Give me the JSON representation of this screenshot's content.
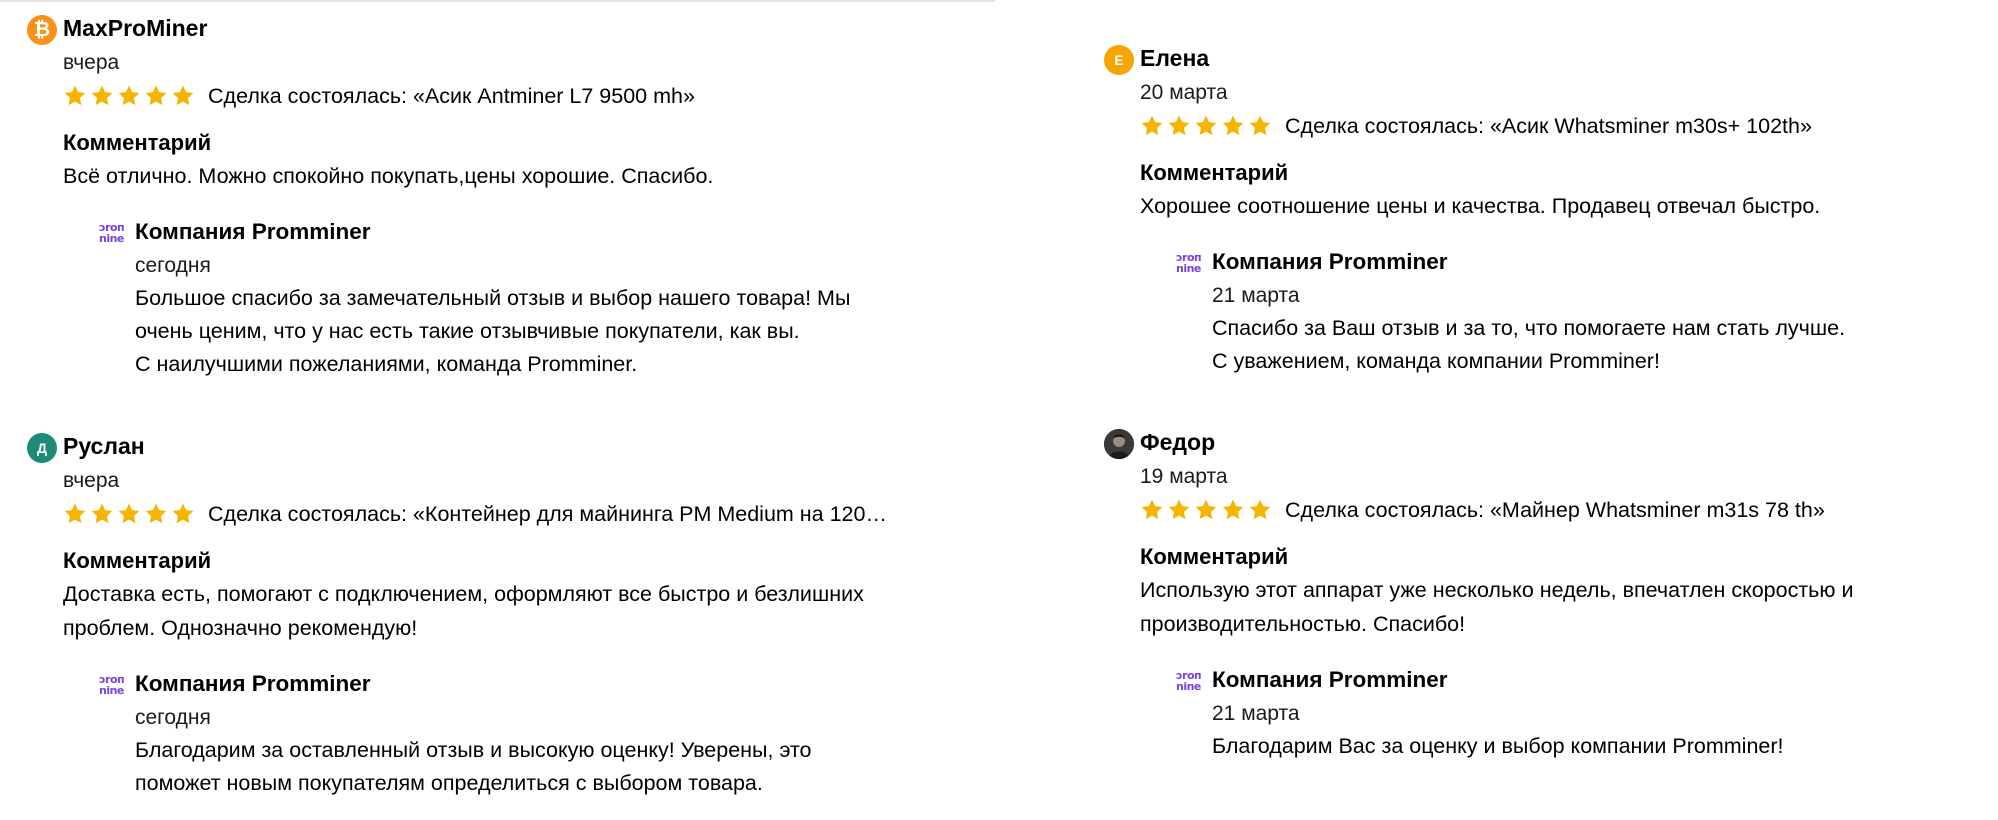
{
  "reviews": [
    {
      "avatar_text": "₿",
      "avatar_color": "#f7931a",
      "author": "MaxProMiner",
      "date": "вчера",
      "rating": 5,
      "deal": "Сделка состоялась: «Асик Antminer L7 9500 mh»",
      "comment_title": "Комментарий",
      "comment": "Всё отлично. Можно спокойно покупать,цены хорошие. Спасибо.",
      "reply": {
        "logo_icon": "prominer-logo-icon",
        "logo_text_top": "ɔroп",
        "logo_text_bottom": "nine",
        "author": "Компания Promminer",
        "date": "сегодня",
        "text": "Большое спасибо за замечательный отзыв и выбор нашего товара! Мы\nочень ценим, что у нас есть такие отзывчивые покупатели, как вы.\nС наилучшими пожеланиями, команда Promminer."
      }
    },
    {
      "avatar_text": "Д",
      "avatar_color": "#1f8a78",
      "author": "Руслан",
      "date": "вчера",
      "rating": 5,
      "deal": "Сделка состоялась: «Контейнер для майнинга PM Medium на 120…",
      "comment_title": "Комментарий",
      "comment": "Доставка есть, помогают с подключением, оформляют все быстро и безлишних\nпроблем. Однозначно рекомендую!",
      "reply": {
        "logo_icon": "prominer-logo-icon",
        "logo_text_top": "ɔroп",
        "logo_text_bottom": "nine",
        "author": "Компания Promminer",
        "date": "сегодня",
        "text": "Благодарим за оставленный отзыв и высокую оценку! Уверены, это\nпоможет новым покупателям определиться с выбором товара."
      }
    },
    {
      "avatar_text": "Е",
      "avatar_color": "#f6a400",
      "author": "Елена",
      "date": "20 марта",
      "rating": 5,
      "deal": "Сделка состоялась: «Асик Whatsminer m30s+ 102th»",
      "comment_title": "Комментарий",
      "comment": "Хорошее соотношение цены и качества. Продавец отвечал быстро.",
      "reply": {
        "logo_icon": "prominer-logo-icon",
        "logo_text_top": "ɔroп",
        "logo_text_bottom": "nine",
        "author": "Компания Promminer",
        "date": "21 марта",
        "text": "Спасибо за Ваш отзыв и за то, что помогаете нам стать лучше.\nС уважением, команда компании Promminer!"
      }
    },
    {
      "avatar_text": "",
      "avatar_color": "#3a3a3a",
      "author": "Федор",
      "date": "19 марта",
      "rating": 5,
      "deal": "Сделка состоялась: «Майнер Whatsminer m31s 78 th»",
      "comment_title": "Комментарий",
      "comment": "Использую этот аппарат уже несколько недель, впечатлен скоростью и\nпроизводительностью. Спасибо!",
      "reply": {
        "logo_icon": "prominer-logo-icon",
        "logo_text_top": "ɔroп",
        "logo_text_bottom": "nine",
        "author": "Компания Promminer",
        "date": "21 марта",
        "text": "Благодарим Вас за оценку и выбор компании Promminer!"
      }
    }
  ],
  "colors": {
    "star": "#f4b400",
    "logo": "#7a42dc"
  }
}
